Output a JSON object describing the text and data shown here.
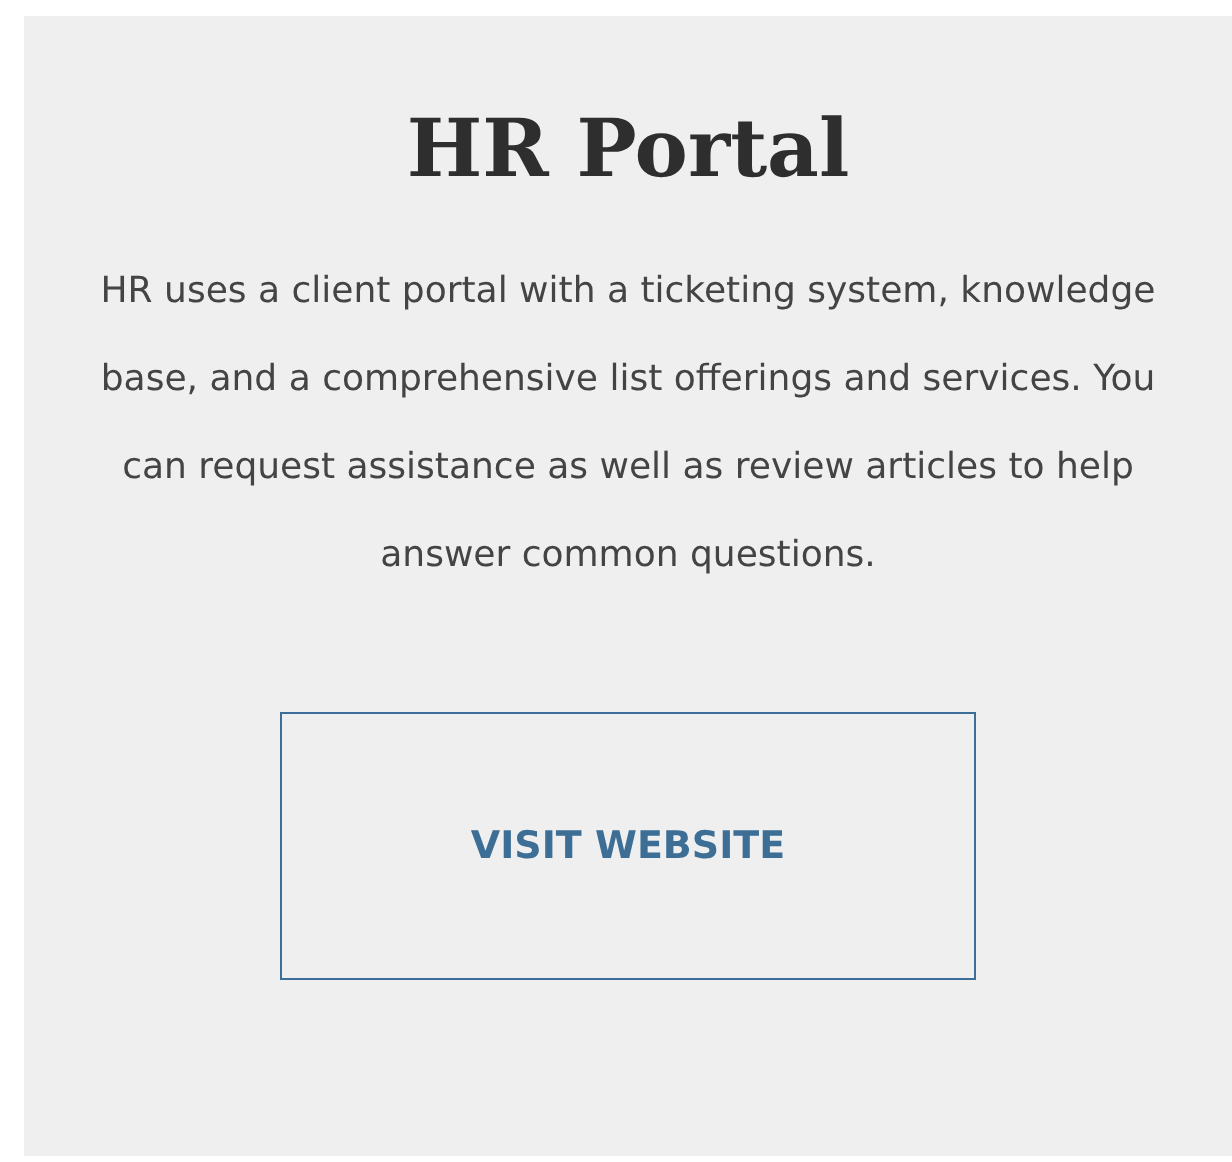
{
  "card": {
    "title": "HR Portal",
    "description": "HR uses a client portal with a ticketing system, knowledge base, and a comprehensive list offerings and services. You can request assistance as well as review articles to help answer common questions.",
    "button": "VISIT WEBSITE"
  }
}
